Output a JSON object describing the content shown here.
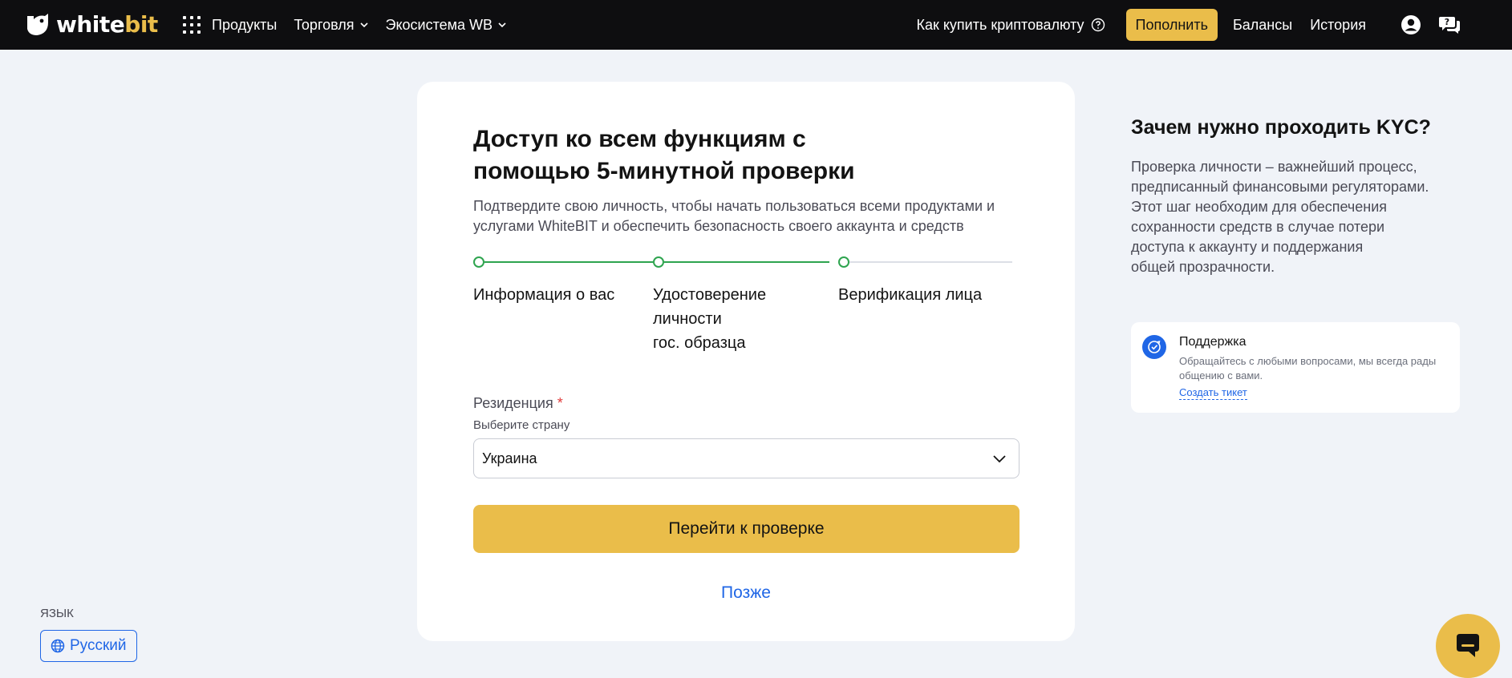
{
  "colors": {
    "accent": "#eabd4a",
    "link": "#1f66e6",
    "step_done": "#2ea44f",
    "header_bg": "#0e0e10",
    "page_bg": "#f0f3f8"
  },
  "header": {
    "logo_text_main": "white",
    "logo_text_accent": "bit",
    "nav": {
      "products": "Продукты",
      "trading": "Торговля",
      "ecosystem": "Экосистема WB"
    },
    "how_to_buy": "Как купить криптовалюту",
    "deposit": "Пополнить",
    "balances": "Балансы",
    "history": "История",
    "icons": [
      "apps-grid-icon",
      "chevron-down-icon",
      "help-circle-icon",
      "user-icon",
      "chat-icon"
    ]
  },
  "card": {
    "title": "Доступ ко всем функциям с помощью 5-минутной проверки",
    "subtitle": "Подтвердите свою личность, чтобы начать пользоваться всеми продуктами и услугами WhiteBIT и обеспечить безопасность своего аккаунта и средств",
    "steps": [
      {
        "label": "Информация о вас"
      },
      {
        "label_lines": [
          "Удостоверение",
          "личности",
          "гос. образца"
        ]
      },
      {
        "label": "Верификация лица"
      }
    ],
    "residence": {
      "label": "Резиденция",
      "required_mark": "*",
      "hint": "Выберите страну",
      "value": "Украина"
    },
    "submit": "Перейти к проверке",
    "later": "Позже"
  },
  "side": {
    "title": "Зачем нужно проходить KYC?",
    "text_lines": [
      "Проверка личности – важнейший процесс,",
      "предписанный финансовыми регуляторами.",
      "Этот шаг необходим для обеспечения",
      "сохранности средств в случае потери",
      "доступа к аккаунту и поддержания",
      "общей прозрачности."
    ],
    "support": {
      "title": "Поддержка",
      "text": "Обращайтесь с любыми вопросами, мы всегда рады общению с вами.",
      "link": "Создать тикет"
    }
  },
  "language": {
    "label": "ЯЗЫК",
    "value": "Русский"
  }
}
